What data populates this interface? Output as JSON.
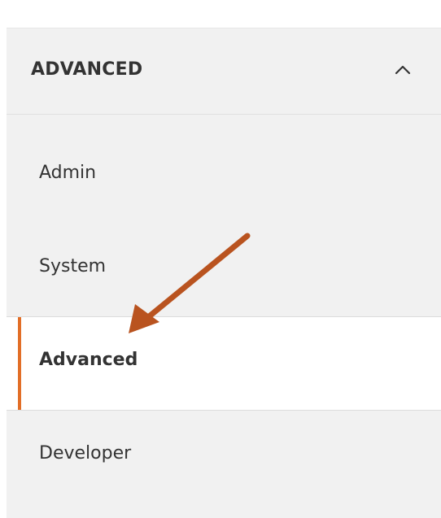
{
  "section": {
    "title": "ADVANCED",
    "toggle_icon": "chevron-up-icon"
  },
  "nav": {
    "items": [
      {
        "label": "Admin",
        "active": false
      },
      {
        "label": "System",
        "active": false
      },
      {
        "label": "Advanced",
        "active": true
      },
      {
        "label": "Developer",
        "active": false
      }
    ]
  },
  "colors": {
    "panel_bg": "#f1f1f1",
    "active_bg": "#ffffff",
    "accent": "#e26e27",
    "annotation_arrow": "#b9531f",
    "text": "#333333"
  },
  "annotation": {
    "icon": "arrow-pointer-icon"
  }
}
